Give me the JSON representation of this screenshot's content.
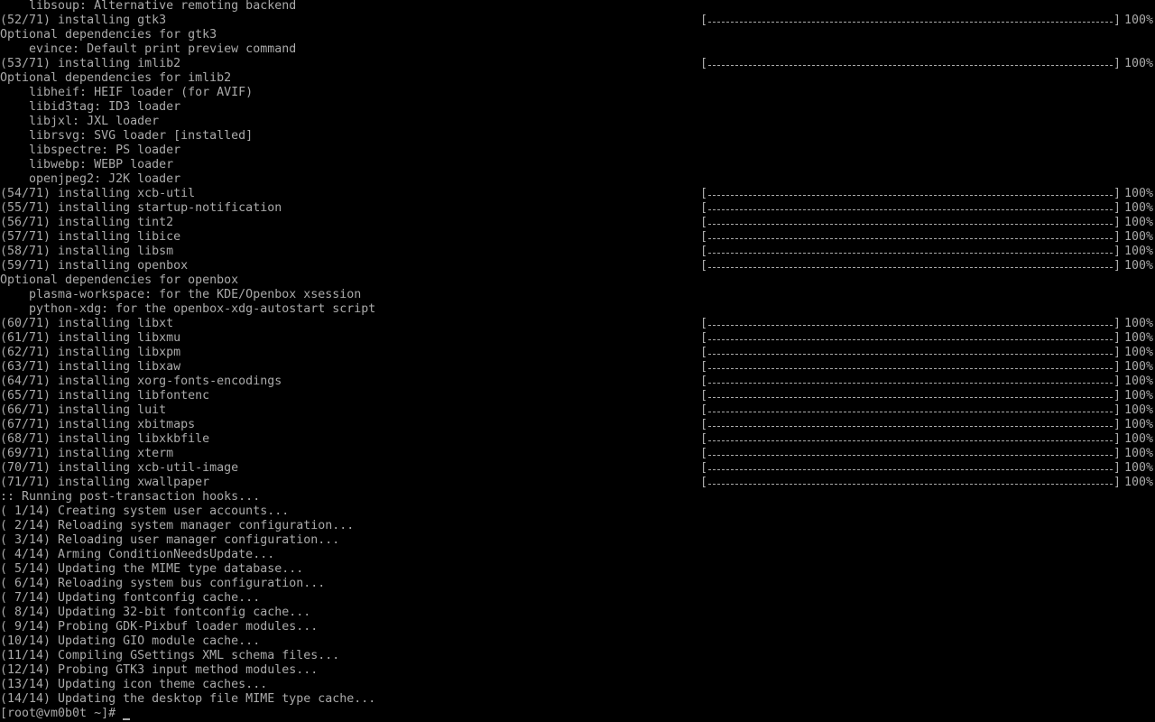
{
  "colors": {
    "background": "#000000",
    "foreground": "#aaaaaa"
  },
  "terminal": {
    "lines": [
      {
        "text": "    libsoup: Alternative remoting backend"
      },
      {
        "text": "(52/71) installing gtk3",
        "progress": 1.0,
        "pct": "100%"
      },
      {
        "text": "Optional dependencies for gtk3"
      },
      {
        "text": "    evince: Default print preview command"
      },
      {
        "text": "(53/71) installing imlib2",
        "progress": 1.0,
        "pct": "100%"
      },
      {
        "text": "Optional dependencies for imlib2"
      },
      {
        "text": "    libheif: HEIF loader (for AVIF)"
      },
      {
        "text": "    libid3tag: ID3 loader"
      },
      {
        "text": "    libjxl: JXL loader"
      },
      {
        "text": "    librsvg: SVG loader [installed]"
      },
      {
        "text": "    libspectre: PS loader"
      },
      {
        "text": "    libwebp: WEBP loader"
      },
      {
        "text": "    openjpeg2: J2K loader"
      },
      {
        "text": "(54/71) installing xcb-util",
        "progress": 1.0,
        "pct": "100%"
      },
      {
        "text": "(55/71) installing startup-notification",
        "progress": 1.0,
        "pct": "100%"
      },
      {
        "text": "(56/71) installing tint2",
        "progress": 1.0,
        "pct": "100%"
      },
      {
        "text": "(57/71) installing libice",
        "progress": 1.0,
        "pct": "100%"
      },
      {
        "text": "(58/71) installing libsm",
        "progress": 1.0,
        "pct": "100%"
      },
      {
        "text": "(59/71) installing openbox",
        "progress": 1.0,
        "pct": "100%"
      },
      {
        "text": "Optional dependencies for openbox"
      },
      {
        "text": "    plasma-workspace: for the KDE/Openbox xsession"
      },
      {
        "text": "    python-xdg: for the openbox-xdg-autostart script"
      },
      {
        "text": "(60/71) installing libxt",
        "progress": 1.0,
        "pct": "100%"
      },
      {
        "text": "(61/71) installing libxmu",
        "progress": 1.0,
        "pct": "100%"
      },
      {
        "text": "(62/71) installing libxpm",
        "progress": 1.0,
        "pct": "100%"
      },
      {
        "text": "(63/71) installing libxaw",
        "progress": 1.0,
        "pct": "100%"
      },
      {
        "text": "(64/71) installing xorg-fonts-encodings",
        "progress": 1.0,
        "pct": "100%"
      },
      {
        "text": "(65/71) installing libfontenc",
        "progress": 1.0,
        "pct": "100%"
      },
      {
        "text": "(66/71) installing luit",
        "progress": 1.0,
        "pct": "100%"
      },
      {
        "text": "(67/71) installing xbitmaps",
        "progress": 1.0,
        "pct": "100%"
      },
      {
        "text": "(68/71) installing libxkbfile",
        "progress": 1.0,
        "pct": "100%"
      },
      {
        "text": "(69/71) installing xterm",
        "progress": 1.0,
        "pct": "100%"
      },
      {
        "text": "(70/71) installing xcb-util-image",
        "progress": 1.0,
        "pct": "100%"
      },
      {
        "text": "(71/71) installing xwallpaper",
        "progress": 1.0,
        "pct": "100%"
      },
      {
        "text": ":: Running post-transaction hooks..."
      },
      {
        "text": "( 1/14) Creating system user accounts..."
      },
      {
        "text": "( 2/14) Reloading system manager configuration..."
      },
      {
        "text": "( 3/14) Reloading user manager configuration..."
      },
      {
        "text": "( 4/14) Arming ConditionNeedsUpdate..."
      },
      {
        "text": "( 5/14) Updating the MIME type database..."
      },
      {
        "text": "( 6/14) Reloading system bus configuration..."
      },
      {
        "text": "( 7/14) Updating fontconfig cache..."
      },
      {
        "text": "( 8/14) Updating 32-bit fontconfig cache..."
      },
      {
        "text": "( 9/14) Probing GDK-Pixbuf loader modules..."
      },
      {
        "text": "(10/14) Updating GIO module cache..."
      },
      {
        "text": "(11/14) Compiling GSettings XML schema files..."
      },
      {
        "text": "(12/14) Probing GTK3 input method modules..."
      },
      {
        "text": "(13/14) Updating icon theme caches..."
      },
      {
        "text": "(14/14) Updating the desktop file MIME type cache..."
      }
    ],
    "prompt": "[root@vm0b0t ~]# "
  }
}
